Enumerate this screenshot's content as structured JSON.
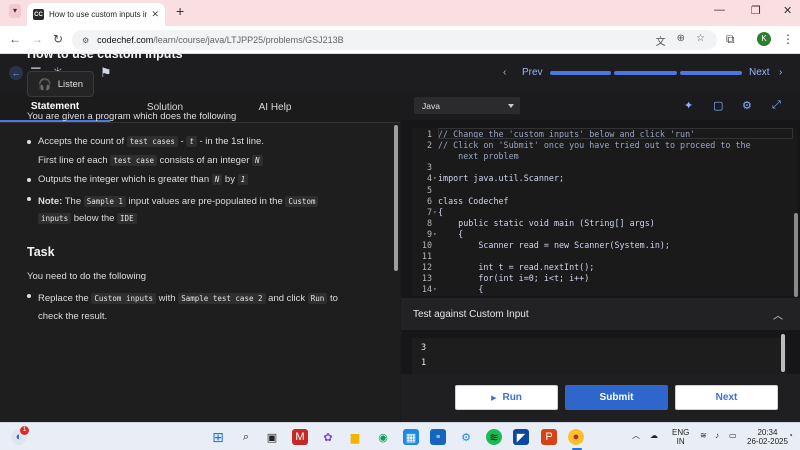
{
  "browser": {
    "tab_favicon": "CC",
    "tab_title": "How to use custom inputs in Ja",
    "url_host": "codechef.com",
    "url_path": "/learn/course/java/LTJPP25/problems/GSJ213B",
    "profile_initial": "K"
  },
  "app": {
    "prev_label": "Prev",
    "next_label": "Next",
    "progress_completed_segments": 3,
    "progress_total_segments": 3
  },
  "left": {
    "tabs": [
      "Statement",
      "Solution",
      "AI Help"
    ],
    "title": "How to use custom inputs",
    "listen_label": "Listen",
    "intro": "You are given a program which does the following",
    "b1_pre": "Accepts the count of ",
    "b1_code": "test cases",
    "b1_mid1": " - ",
    "b1_var": "t",
    "b1_post": " - in the 1st line.",
    "b1b_pre": "First line of each ",
    "b1b_code": "test case",
    "b1b_mid": " consists of an integer ",
    "b1b_var": "N",
    "b2_pre": "Outputs the integer which is greater than ",
    "b2_var1": "N",
    "b2_mid": " by ",
    "b2_var2": "1",
    "b3_bold": "Note:",
    "b3_pre": " The ",
    "b3_code1": "Sample 1",
    "b3_mid1": " input values are pre-populated in the ",
    "b3_code2": "Custom",
    "b3_code3": "inputs",
    "b3_mid2": " below the ",
    "b3_code4": "IDE",
    "task_heading": "Task",
    "task_intro": "You need to do the following",
    "t1_pre": "Replace the ",
    "t1_code1": "Custom inputs",
    "t1_mid1": " with ",
    "t1_code2": "Sample test case 2",
    "t1_mid2": " and click ",
    "t1_code3": "Run",
    "t1_post": " to",
    "t1_line2": "check the result."
  },
  "editor": {
    "language": "Java",
    "lines": [
      {
        "n": "1",
        "fold": "",
        "text": "// Change the 'custom inputs' below and click 'run'",
        "cls": "cm"
      },
      {
        "n": "2",
        "fold": "",
        "text": "// Click on 'Submit' once you have tried out to proceed to the",
        "cls": "cm"
      },
      {
        "n": "",
        "fold": "",
        "text": "    next problem",
        "cls": "cm"
      },
      {
        "n": "3",
        "fold": "",
        "text": "",
        "cls": ""
      },
      {
        "n": "4",
        "fold": "v",
        "text": "import java.util.Scanner;",
        "cls": ""
      },
      {
        "n": "5",
        "fold": "",
        "text": "",
        "cls": ""
      },
      {
        "n": "6",
        "fold": "",
        "text": "class Codechef",
        "cls": ""
      },
      {
        "n": "7",
        "fold": "v",
        "text": "{",
        "cls": ""
      },
      {
        "n": "8",
        "fold": "",
        "text": "    public static void main (String[] args)",
        "cls": ""
      },
      {
        "n": "9",
        "fold": "v",
        "text": "    {",
        "cls": ""
      },
      {
        "n": "10",
        "fold": "",
        "text": "        Scanner read = new Scanner(System.in);",
        "cls": ""
      },
      {
        "n": "11",
        "fold": "",
        "text": "",
        "cls": ""
      },
      {
        "n": "12",
        "fold": "",
        "text": "        int t = read.nextInt();",
        "cls": ""
      },
      {
        "n": "13",
        "fold": "",
        "text": "        for(int i=0; i<t; i++)",
        "cls": ""
      },
      {
        "n": "14",
        "fold": "v",
        "text": "        {",
        "cls": ""
      }
    ]
  },
  "custom_input": {
    "header": "Test against Custom Input",
    "lines": [
      "3",
      "1"
    ]
  },
  "buttons": {
    "run": "Run",
    "submit": "Submit",
    "next": "Next"
  },
  "taskbar": {
    "notif_badge": "1",
    "lang_line1": "ENG",
    "lang_line2": "IN",
    "time": "20:34",
    "date": "26-02-2025"
  }
}
